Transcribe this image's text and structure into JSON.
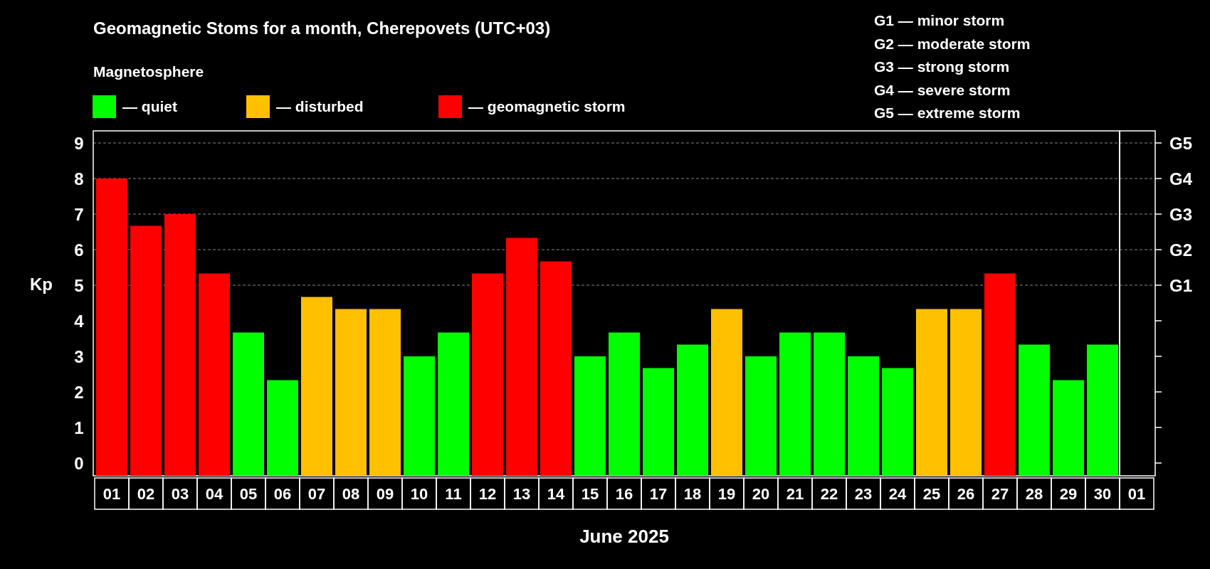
{
  "title": "Geomagnetic Stoms for a month, Cherepovets (UTC+03)",
  "legend": {
    "title": "Magnetosphere",
    "items": [
      {
        "label": "— quiet",
        "color": "#00ff00"
      },
      {
        "label": "— disturbed",
        "color": "#ffc000"
      },
      {
        "label": "— geomagnetic storm",
        "color": "#ff0000"
      }
    ]
  },
  "storm_scale": [
    "G1 — minor storm",
    "G2 — moderate storm",
    "G3 — strong storm",
    "G4 — severe storm",
    "G5 — extreme storm"
  ],
  "chart_data": {
    "type": "bar",
    "xlabel": "June 2025",
    "ylabel": "Kp",
    "categories": [
      "01",
      "02",
      "03",
      "04",
      "05",
      "06",
      "07",
      "08",
      "09",
      "10",
      "11",
      "12",
      "13",
      "14",
      "15",
      "16",
      "17",
      "18",
      "19",
      "20",
      "21",
      "22",
      "23",
      "24",
      "25",
      "26",
      "27",
      "28",
      "29",
      "30",
      "01"
    ],
    "values": [
      8,
      6.67,
      7,
      5.33,
      3.67,
      2.33,
      4.67,
      4.33,
      4.33,
      3,
      3.67,
      5.33,
      6.33,
      5.67,
      3,
      3.67,
      2.67,
      3.33,
      4.33,
      3,
      3.67,
      3.67,
      3,
      2.67,
      4.33,
      4.33,
      5.33,
      3.33,
      2.33,
      3.33,
      null
    ],
    "ylim": [
      0,
      9
    ],
    "yticks": [
      0,
      1,
      2,
      3,
      4,
      5,
      6,
      7,
      8,
      9
    ],
    "grid": true
  },
  "storm_levels": [
    "G5",
    "G4",
    "G3",
    "G2",
    "G1"
  ]
}
